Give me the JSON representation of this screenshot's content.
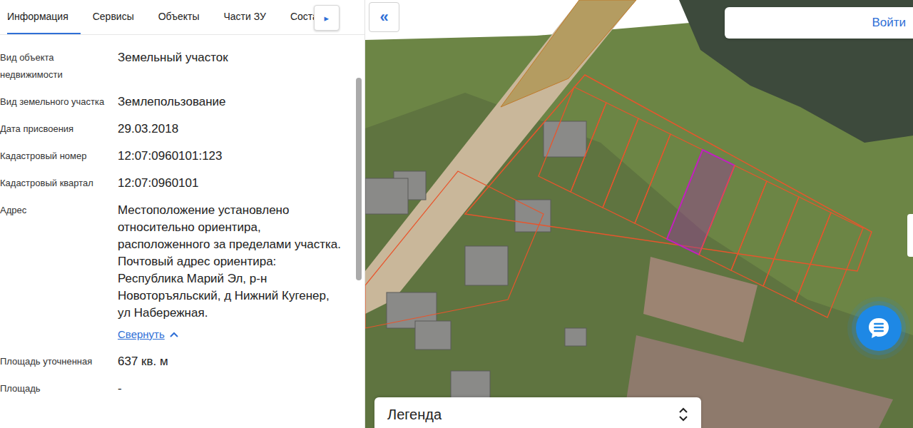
{
  "tabs": [
    {
      "label": "Информация",
      "selected": true
    },
    {
      "label": "Сервисы",
      "selected": false
    },
    {
      "label": "Объекты",
      "selected": false
    },
    {
      "label": "Части ЗУ",
      "selected": false
    },
    {
      "label": "Соста",
      "selected": false
    }
  ],
  "tabs_more": "▸",
  "fields": [
    {
      "label": "Вид объекта недвижимости",
      "value": "Земельный участок"
    },
    {
      "label": "Вид земельного участка",
      "value": "Землепользование"
    },
    {
      "label": "Дата присвоения",
      "value": "29.03.2018"
    },
    {
      "label": "Кадастровый номер",
      "value": "12:07:0960101:123"
    },
    {
      "label": "Кадастровый квартал",
      "value": "12:07:0960101"
    },
    {
      "label": "Адрес",
      "value": "Местоположение установлено относительно ориентира, расположенного за пределами участка. Почтовый адрес ориентира: Республика Марий Эл, р-н Новоторъяльский, д Нижний Кугенер, ул Набережная.",
      "link": "Свернуть"
    },
    {
      "label": "Площадь уточненная",
      "value": "637 кв. м"
    },
    {
      "label": "Площадь",
      "value": "-"
    }
  ],
  "map": {
    "collapse": "«",
    "login": "Войти",
    "legend": "Легенда"
  }
}
